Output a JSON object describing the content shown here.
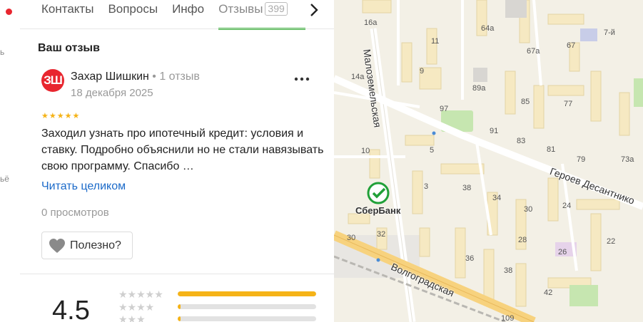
{
  "left_rail": {
    "fragments": [
      "ь",
      "ьё"
    ]
  },
  "tabs": {
    "items": [
      {
        "label": "Контакты"
      },
      {
        "label": "Вопросы"
      },
      {
        "label": "Инфо"
      },
      {
        "label": "Отзывы",
        "count": "399"
      }
    ],
    "next_icon": "chevron-right-icon"
  },
  "review": {
    "section_title": "Ваш отзыв",
    "avatar_initials": "ЗШ",
    "author_name": "Захар Шишкин",
    "author_meta": " • 1 отзыв",
    "date": "18 декабря 2025",
    "stars": "★★★★★",
    "rating": 5,
    "text": "Заходил узнать про ипотечный кредит: условия и ставку. Подробно объяснили но не стали навязывать свою программу. Спасибо …",
    "read_more": "Читать целиком",
    "views": "0 просмотров",
    "helpful_label": "Полезно?",
    "more_icon": "more-dots-icon"
  },
  "rating_summary": {
    "average": "4.5",
    "rows": [
      {
        "stars": "★★★★★",
        "fraction": 1.0
      },
      {
        "stars": "★★★★",
        "fraction": 0.02
      },
      {
        "stars": "★★★",
        "fraction": 0.02
      }
    ]
  },
  "map": {
    "poi_label": "СберБанк",
    "streets": [
      "Малоземельская",
      "Героев Десантнико",
      "Волгоградская"
    ],
    "house_numbers": [
      "16а",
      "11",
      "64а",
      "67а",
      "67",
      "7-й",
      "14а",
      "9",
      "89а",
      "85",
      "77",
      "97",
      "91",
      "83",
      "81",
      "79",
      "73а",
      "10",
      "5",
      "38",
      "34",
      "30",
      "24",
      "3",
      "32",
      "28",
      "30",
      "36",
      "22",
      "26",
      "38",
      "42",
      "109"
    ],
    "colors": {
      "background": "#f3f0e6",
      "building": "#f6e9c2",
      "road": "#ffffff",
      "main_road": "#f7d27e",
      "park": "#c6e6b0",
      "accent_green": "#3bb33b",
      "rating_yellow": "#f5b317",
      "link_blue": "#1b6ac9"
    }
  }
}
